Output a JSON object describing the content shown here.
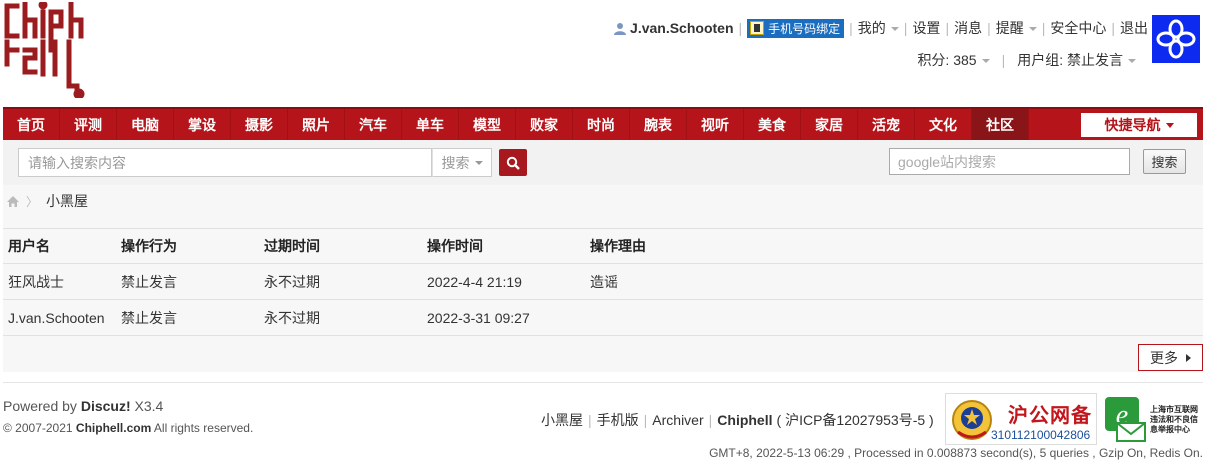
{
  "header": {
    "username": "J.van.Schooten",
    "bind_phone": "手机号码绑定",
    "menu": [
      "我的",
      "设置",
      "消息",
      "提醒",
      "安全中心",
      "退出"
    ],
    "points": "积分: 385",
    "usergroup": "用户组: 禁止发言"
  },
  "nav": {
    "items": [
      "首页",
      "评测",
      "电脑",
      "掌设",
      "摄影",
      "照片",
      "汽车",
      "单车",
      "模型",
      "败家",
      "时尚",
      "腕表",
      "视听",
      "美食",
      "家居",
      "活宠",
      "文化",
      "社区"
    ],
    "active_index": 17,
    "quick_nav": "快捷导航"
  },
  "search": {
    "placeholder": "请输入搜索内容",
    "type_label": "搜索",
    "google_placeholder": "google站内搜索",
    "google_button": "搜索"
  },
  "breadcrumb": {
    "current": "小黑屋"
  },
  "table": {
    "headers": [
      "用户名",
      "操作行为",
      "过期时间",
      "操作时间",
      "操作理由"
    ],
    "rows": [
      [
        "狂风战士",
        "禁止发言",
        "永不过期",
        "2022-4-4 21:19",
        "造谣"
      ],
      [
        "J.van.Schooten",
        "禁止发言",
        "永不过期",
        "2022-3-31 09:27",
        ""
      ]
    ],
    "more_label": "更多"
  },
  "footer": {
    "powered_prefix": "Powered by ",
    "powered_brand": "Discuz!",
    "powered_version": " X3.4",
    "copyright_prefix": "© 2007-2021 ",
    "copyright_site": "Chiphell.com",
    "copyright_suffix": " All rights reserved.",
    "links": [
      "小黑屋",
      "手机版",
      "Archiver"
    ],
    "site_name": "Chiphell",
    "icp": "( 沪ICP备12027953号-5 )",
    "badge_title": "沪公网备",
    "badge_number": "310112100042806",
    "badge2_text": "上海市互联网违法和不良信息举报中心",
    "stats": "GMT+8, 2022-5-13 06:29 , Processed in 0.008873 second(s), 5 queries , Gzip On, Redis On."
  },
  "colors": {
    "brand_red": "#b5151a",
    "avatar_blue": "#0d2bf0"
  }
}
